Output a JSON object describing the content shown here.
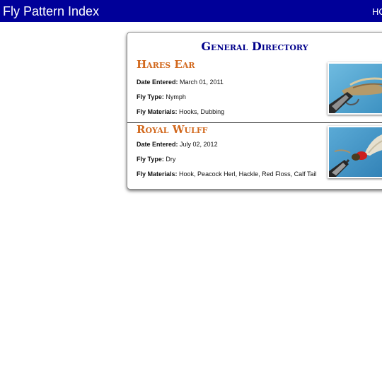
{
  "header": {
    "site_title": "Fly Pattern Index",
    "nav_home": "HOME"
  },
  "directory": {
    "title": "General Directory",
    "labels": {
      "date": "Date Entered:",
      "type": "Fly Type:",
      "materials": "Fly Materials:"
    },
    "entries": [
      {
        "name": "Hares Ear",
        "date": "March 01, 2011",
        "type": "Nymph",
        "materials": "Hooks, Dubbing",
        "image_icon": "fly-photo-icon"
      },
      {
        "name": "Royal Wulff",
        "date": "July 02, 2012",
        "type": "Dry",
        "materials": "Hook, Peacock Herl, Hackle, Red Floss, Calf Tail",
        "image_icon": "fly-photo-icon"
      }
    ]
  },
  "colors": {
    "header_bg": "#000099",
    "title": "#00008b",
    "fly_name": "#d2691e",
    "photo_bg": "#4fa6cf"
  }
}
